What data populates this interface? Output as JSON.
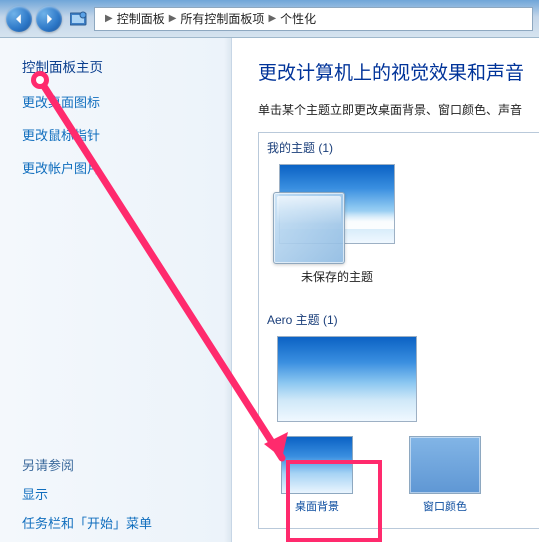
{
  "nav": {
    "crumb1": "控制面板",
    "crumb2": "所有控制面板项",
    "crumb3": "个性化"
  },
  "sidebar": {
    "home": "控制面板主页",
    "links": [
      "更改桌面图标",
      "更改鼠标指针",
      "更改帐户图片"
    ],
    "seealso_title": "另请参阅",
    "seealso_links": [
      "显示",
      "任务栏和「开始」菜单"
    ]
  },
  "content": {
    "heading": "更改计算机上的视觉效果和声音",
    "desc": "单击某个主题立即更改桌面背景、窗口颜色、声音",
    "my_themes_title": "我的主题 (1)",
    "unsaved_theme": "未保存的主题",
    "aero_title": "Aero 主题 (1)",
    "bottom": {
      "desktop_bg": "桌面背景",
      "window_color": "窗口颜色"
    }
  }
}
